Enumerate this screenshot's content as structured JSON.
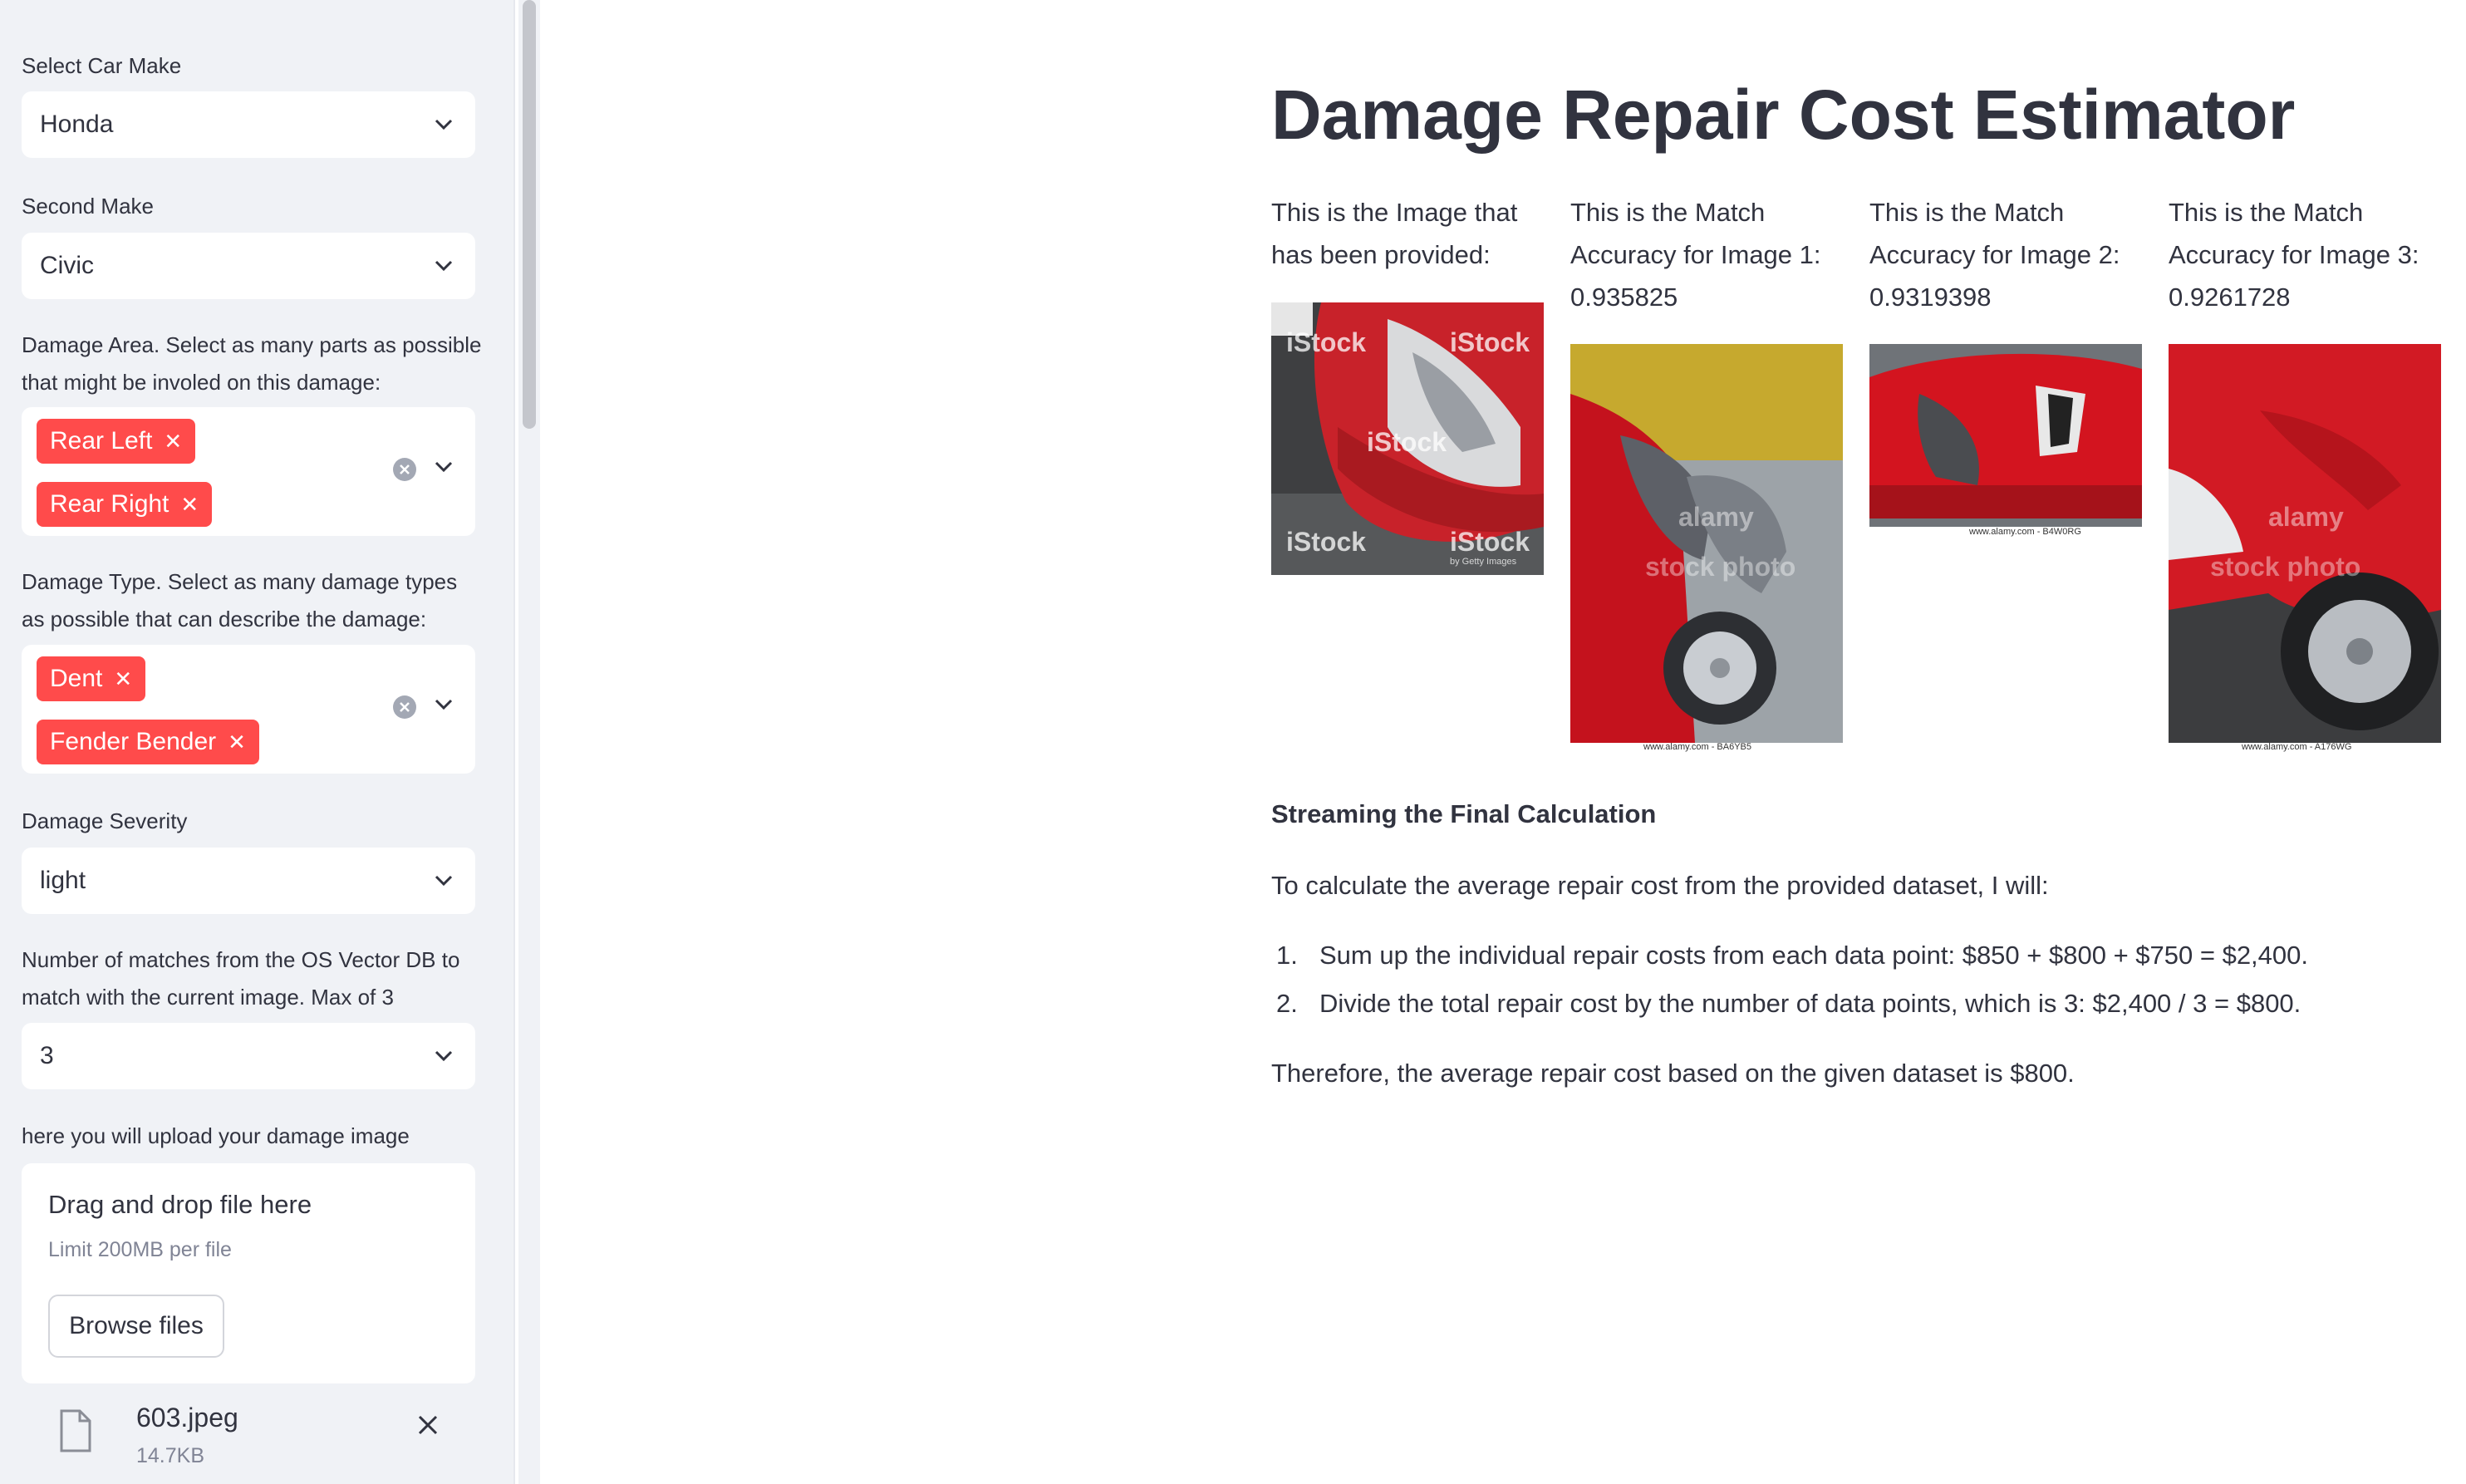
{
  "sidebar": {
    "car_make": {
      "label": "Select Car Make",
      "value": "Honda"
    },
    "second_make": {
      "label": "Second Make",
      "value": "Civic"
    },
    "damage_area": {
      "label_line1": "Damage Area. Select as many parts as possible",
      "label_line2": "that might be involed on this damage:",
      "tags": [
        "Rear Left",
        "Rear Right"
      ]
    },
    "damage_type": {
      "label_line1": "Damage Type. Select as many damage types",
      "label_line2": "as possible that can describe the damage:",
      "tags": [
        "Dent",
        "Fender Bender"
      ]
    },
    "severity": {
      "label": "Damage Severity",
      "value": "light"
    },
    "matches": {
      "label_line1": "Number of matches from the OS Vector DB to",
      "label_line2": "match with the current image. Max of 3",
      "value": "3"
    },
    "upload": {
      "label": "here you will upload your damage image",
      "title": "Drag and drop file here",
      "limit": "Limit 200MB per file",
      "browse_label": "Browse files"
    },
    "file": {
      "name": "603.jpeg",
      "size": "14.7KB"
    }
  },
  "main": {
    "title": "Damage Repair Cost Estimator",
    "columns": [
      {
        "caption_line1": "This is the Image that",
        "caption_line2": "has been provided:",
        "caption_line3": ""
      },
      {
        "caption_line1": "This is the Match",
        "caption_line2": "Accuracy for Image 1:",
        "caption_line3": "0.935825"
      },
      {
        "caption_line1": "This is the Match",
        "caption_line2": "Accuracy for Image 2:",
        "caption_line3": "0.9319398"
      },
      {
        "caption_line1": "This is the Match",
        "caption_line2": "Accuracy for Image 3:",
        "caption_line3": "0.9261728"
      }
    ],
    "watermarks": {
      "istock": "iStock",
      "gettyimages": "by Getty Images",
      "alamy": "alamy",
      "stock_photo": "stock photo",
      "stamp1": "www.alamy.com - BA6YB5",
      "stamp2": "www.alamy.com - B4W0RG",
      "stamp3": "www.alamy.com - A176WG"
    },
    "section_heading": "Streaming the Final Calculation",
    "intro": "To calculate the average repair cost from the provided dataset, I will:",
    "steps": [
      {
        "num": "1.",
        "text": "Sum up the individual repair costs from each data point: $850 + $800 + $750 = $2,400."
      },
      {
        "num": "2.",
        "text": "Divide the total repair cost by the number of data points, which is 3: $2,400 / 3 = $800."
      }
    ],
    "conclusion": "Therefore, the average repair cost based on the given dataset is $800."
  },
  "colors": {
    "accent": "#ff4b4b",
    "sidebar_bg": "#f0f2f6",
    "text": "#31333f"
  }
}
